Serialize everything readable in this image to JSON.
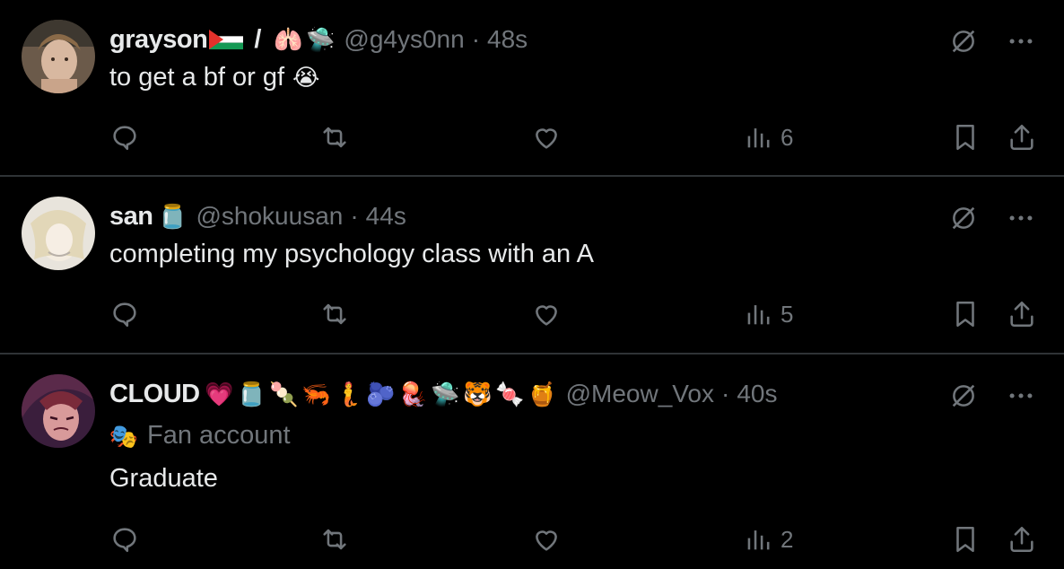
{
  "tweets": [
    {
      "name": "grayson",
      "name_suffix": "/",
      "handle": "@g4ys0nn",
      "time": "48s",
      "text": "to get a bf or gf",
      "text_emoji": "😭",
      "emojis": [
        "🫁",
        "🛸"
      ],
      "views": "6"
    },
    {
      "name": "san",
      "handle": "@shokuusan",
      "time": "44s",
      "text": "completing my psychology class with an A",
      "emojis": [
        "🫙"
      ],
      "views": "5"
    },
    {
      "name": "CLOUD",
      "handle": "@Meow_Vox",
      "time": "40s",
      "subtitle": "Fan account",
      "subtitle_emoji": "🎭",
      "text": "Graduate",
      "emojis": [
        "💗",
        "🫙",
        "🍡",
        "🦐",
        "🧜",
        "🫐",
        "🪼",
        "🛸",
        "🐯",
        "🍬",
        "🍯"
      ],
      "views": "2"
    }
  ],
  "dot": "·",
  "colors": {
    "background": "#000000",
    "text": "#e7e9ea",
    "muted": "#71767b",
    "divider": "#2f3336"
  }
}
